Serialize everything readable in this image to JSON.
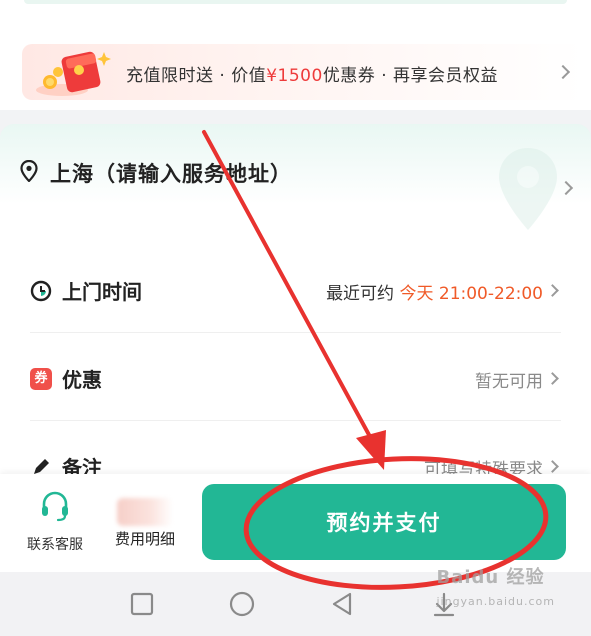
{
  "promo": {
    "text_prefix": "充值限时送 · 价值",
    "highlight": "¥1500",
    "text_suffix": "优惠券 · 再享会员权益"
  },
  "address": {
    "text": "上海（请输入服务地址）"
  },
  "rows": {
    "time": {
      "label": "上门时间",
      "value_prefix": "最近可约 ",
      "value_highlight": "今天 21:00-22:00"
    },
    "coupon": {
      "icon_text": "券",
      "label": "优惠",
      "value": "暂无可用"
    },
    "note": {
      "label": "备注",
      "value": "可填写特殊要求"
    }
  },
  "bottom": {
    "service_label": "联系客服",
    "fee_label": "费用明细",
    "pay_label": "预约并支付"
  },
  "watermark": {
    "text": "Baidu 经验",
    "sub": "jingyan.baidu.com"
  },
  "colors": {
    "accent": "#22b795",
    "highlight_red": "#ee3b3b",
    "highlight_orange": "#f05a28",
    "annotation_red": "#e8322f"
  }
}
